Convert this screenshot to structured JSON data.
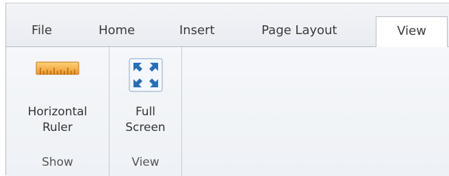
{
  "tabs": [
    {
      "label": "File"
    },
    {
      "label": "Home"
    },
    {
      "label": "Insert"
    },
    {
      "label": "Page Layout"
    },
    {
      "label": "View",
      "active": true
    }
  ],
  "groups": {
    "show": {
      "label": "Show",
      "commands": {
        "horizontal_ruler": {
          "label_line1": "Horizontal",
          "label_line2": "Ruler",
          "icon": "ruler-icon"
        }
      }
    },
    "view": {
      "label": "View",
      "commands": {
        "full_screen": {
          "label_line1": "Full",
          "label_line2": "Screen",
          "icon": "full-screen-icon"
        }
      }
    }
  },
  "colors": {
    "ruler_fill": "#f0a23a",
    "full_screen_arrow": "#2a6fb6"
  }
}
